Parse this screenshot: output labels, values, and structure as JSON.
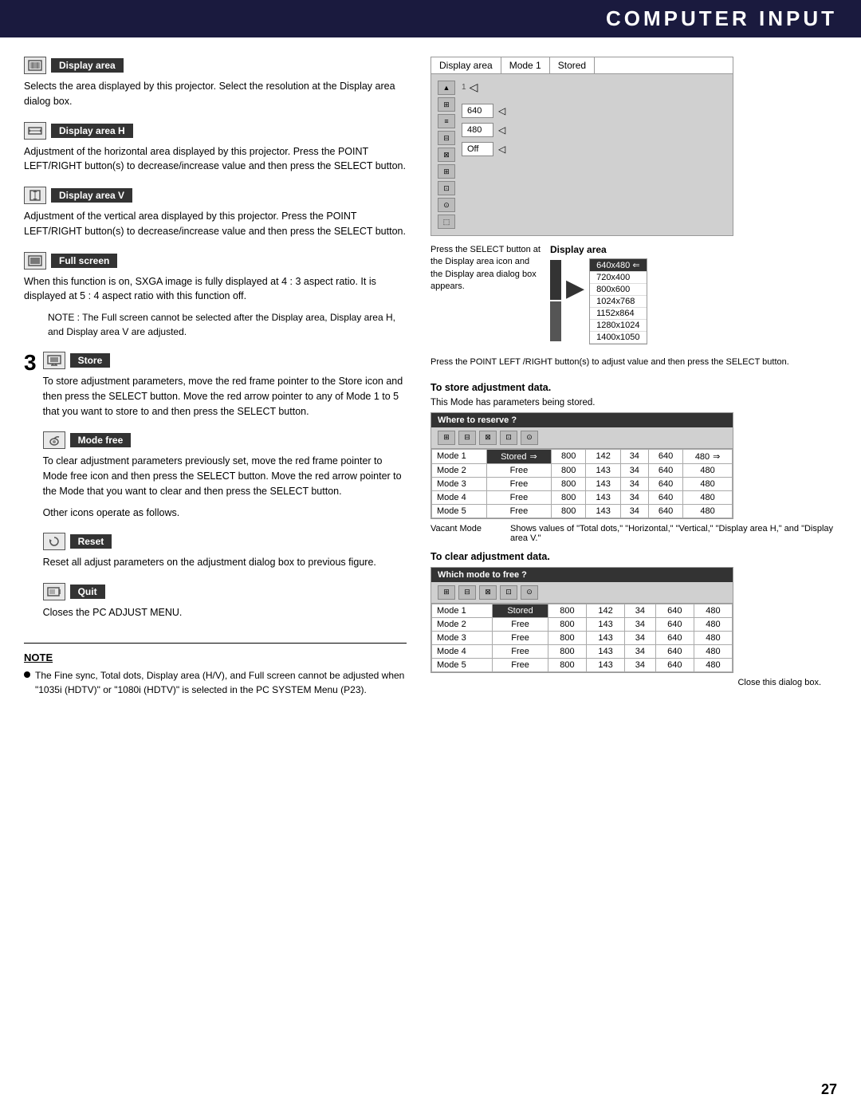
{
  "header": {
    "title": "COMPUTER INPUT"
  },
  "page_number": "27",
  "left_column": {
    "display_area": {
      "label": "Display area",
      "description": "Selects the area displayed by this projector.  Select the resolution at the Display area dialog box."
    },
    "display_area_h": {
      "label": "Display area H",
      "description": "Adjustment of the horizontal area displayed by this projector.  Press the POINT LEFT/RIGHT button(s) to decrease/increase value and then press the SELECT button."
    },
    "display_area_v": {
      "label": "Display area V",
      "description": "Adjustment of the vertical area displayed by this projector.  Press the POINT LEFT/RIGHT button(s) to decrease/increase value and then press the SELECT button."
    },
    "full_screen": {
      "label": "Full screen",
      "description": "When this function is on, SXGA image is fully displayed at 4 : 3 aspect ratio.  It is displayed at 5 : 4 aspect ratio with this function off.",
      "note": "NOTE : The Full screen cannot be selected after the Display area, Display area H, and Display area V are adjusted."
    },
    "step3": {
      "number": "3",
      "store": {
        "label": "Store",
        "description": "To store adjustment parameters, move the red frame pointer to the Store icon and then press the SELECT button. Move the red arrow pointer to any of Mode 1 to 5 that you want to store to and then press the SELECT button."
      },
      "mode_free": {
        "label": "Mode free",
        "description": "To clear adjustment parameters previously set, move the red frame pointer to Mode free icon and then press the SELECT button.  Move the red arrow pointer to the Mode that you want to clear and then press the SELECT button."
      },
      "other_icons": "Other icons operate as follows.",
      "reset": {
        "label": "Reset",
        "description": "Reset all adjust parameters on the adjustment dialog box to previous figure."
      },
      "quit": {
        "label": "Quit",
        "description": "Closes the PC ADJUST MENU."
      }
    },
    "note": {
      "title": "NOTE",
      "bullet": "The Fine sync, Total dots, Display area (H/V), and Full screen cannot be adjusted when \"1035i (HDTV)\" or \"1080i (HDTV)\" is selected in the PC SYSTEM Menu (P23)."
    }
  },
  "right_column": {
    "dialog": {
      "title_cells": [
        "Display area",
        "Mode 1",
        "Stored"
      ],
      "call_out_note": "Press the SELECT button at the Display area icon and the Display area dialog box appears.",
      "display_area_label": "Display area",
      "resolutions": [
        {
          "value": "640x480",
          "selected": true
        },
        {
          "value": "720x400",
          "selected": false
        },
        {
          "value": "800x600",
          "selected": false
        },
        {
          "value": "1024x768",
          "selected": false
        },
        {
          "value": "1152x864",
          "selected": false
        },
        {
          "value": "1280x1024",
          "selected": false
        },
        {
          "value": "1400x1050",
          "selected": false
        }
      ],
      "h_value": "640",
      "v_value": "480",
      "off_value": "Off",
      "adjust_note": "Press the POINT LEFT /RIGHT button(s) to adjust value and then press the SELECT button."
    },
    "store_section": {
      "title": "To store adjustment data.",
      "note": "This Mode has parameters being stored.",
      "table_header": "Where to reserve ?",
      "modes": [
        {
          "mode": "Mode 1",
          "status": "Stored",
          "v1": "800",
          "v2": "142",
          "v3": "34",
          "v4": "640",
          "v5": "480"
        },
        {
          "mode": "Mode 2",
          "status": "Free",
          "v1": "800",
          "v2": "143",
          "v3": "34",
          "v4": "640",
          "v5": "480"
        },
        {
          "mode": "Mode 3",
          "status": "Free",
          "v1": "800",
          "v2": "143",
          "v3": "34",
          "v4": "640",
          "v5": "480"
        },
        {
          "mode": "Mode 4",
          "status": "Free",
          "v1": "800",
          "v2": "143",
          "v3": "34",
          "v4": "640",
          "v5": "480"
        },
        {
          "mode": "Mode 5",
          "status": "Free",
          "v1": "800",
          "v2": "143",
          "v3": "34",
          "v4": "640",
          "v5": "480"
        }
      ],
      "vacant_mode_label": "Vacant Mode",
      "values_note": "Shows values of \"Total dots,\" \"Horizontal,\" \"Vertical,\" \"Display area H,\" and \"Display area V.\""
    },
    "clear_section": {
      "title": "To clear adjustment data.",
      "table_header": "Which mode to free ?",
      "modes": [
        {
          "mode": "Mode 1",
          "status": "Stored",
          "v1": "800",
          "v2": "142",
          "v3": "34",
          "v4": "640",
          "v5": "480"
        },
        {
          "mode": "Mode 2",
          "status": "Free",
          "v1": "800",
          "v2": "143",
          "v3": "34",
          "v4": "640",
          "v5": "480"
        },
        {
          "mode": "Mode 3",
          "status": "Free",
          "v1": "800",
          "v2": "143",
          "v3": "34",
          "v4": "640",
          "v5": "480"
        },
        {
          "mode": "Mode 4",
          "status": "Free",
          "v1": "800",
          "v2": "143",
          "v3": "34",
          "v4": "640",
          "v5": "480"
        },
        {
          "mode": "Mode 5",
          "status": "Free",
          "v1": "800",
          "v2": "143",
          "v3": "34",
          "v4": "640",
          "v5": "480"
        }
      ],
      "close_note": "Close this dialog box."
    }
  }
}
